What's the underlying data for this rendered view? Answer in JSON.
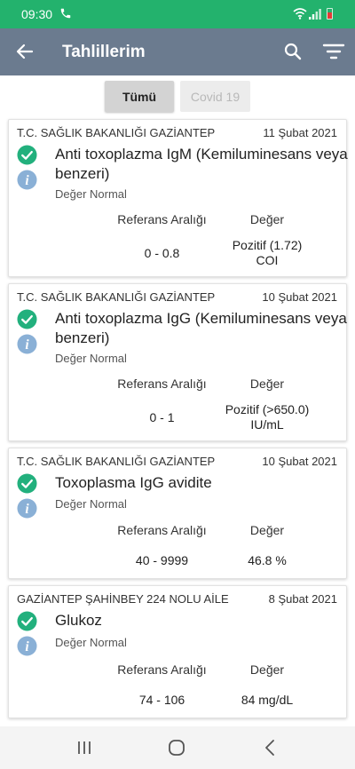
{
  "status_bar": {
    "time": "09:30"
  },
  "app_bar": {
    "title": "Tahlillerim"
  },
  "tabs": [
    {
      "label": "Tümü",
      "selected": true
    },
    {
      "label": "Covid 19",
      "selected": false
    }
  ],
  "columns": {
    "reference": "Referans Aralığı",
    "value": "Değer"
  },
  "colors": {
    "status_bar": "#23b26d",
    "app_bar": "#6b7b8f",
    "check": "#22b07d",
    "info": "#8ab0d6"
  },
  "results": [
    {
      "institution": "T.C. SAĞLIK BAKANLIĞI GAZİANTEP",
      "date": "11 Şubat 2021",
      "test": "Anti toxoplazma IgM (Kemiluminesans veya benzeri)",
      "status": "Değer Normal",
      "reference": "0 - 0.8",
      "value": "Pozitif (1.72)",
      "unit": "COI"
    },
    {
      "institution": "T.C. SAĞLIK BAKANLIĞI GAZİANTEP",
      "date": "10 Şubat 2021",
      "test": "Anti toxoplazma IgG (Kemiluminesans veya benzeri)",
      "status": "Değer Normal",
      "reference": "0 - 1",
      "value": "Pozitif (>650.0)",
      "unit": "IU/mL"
    },
    {
      "institution": "T.C. SAĞLIK BAKANLIĞI GAZİANTEP",
      "date": "10 Şubat 2021",
      "test": "Toxoplasma IgG avidite",
      "status": "Değer Normal",
      "reference": "40 - 9999",
      "value": "46.8 %"
    },
    {
      "institution": "GAZİANTEP ŞAHİNBEY 224 NOLU AİLE",
      "date": "8 Şubat 2021",
      "test": "Glukoz",
      "status": "Değer Normal",
      "reference": "74 - 106",
      "value": "84 mg/dL"
    }
  ]
}
